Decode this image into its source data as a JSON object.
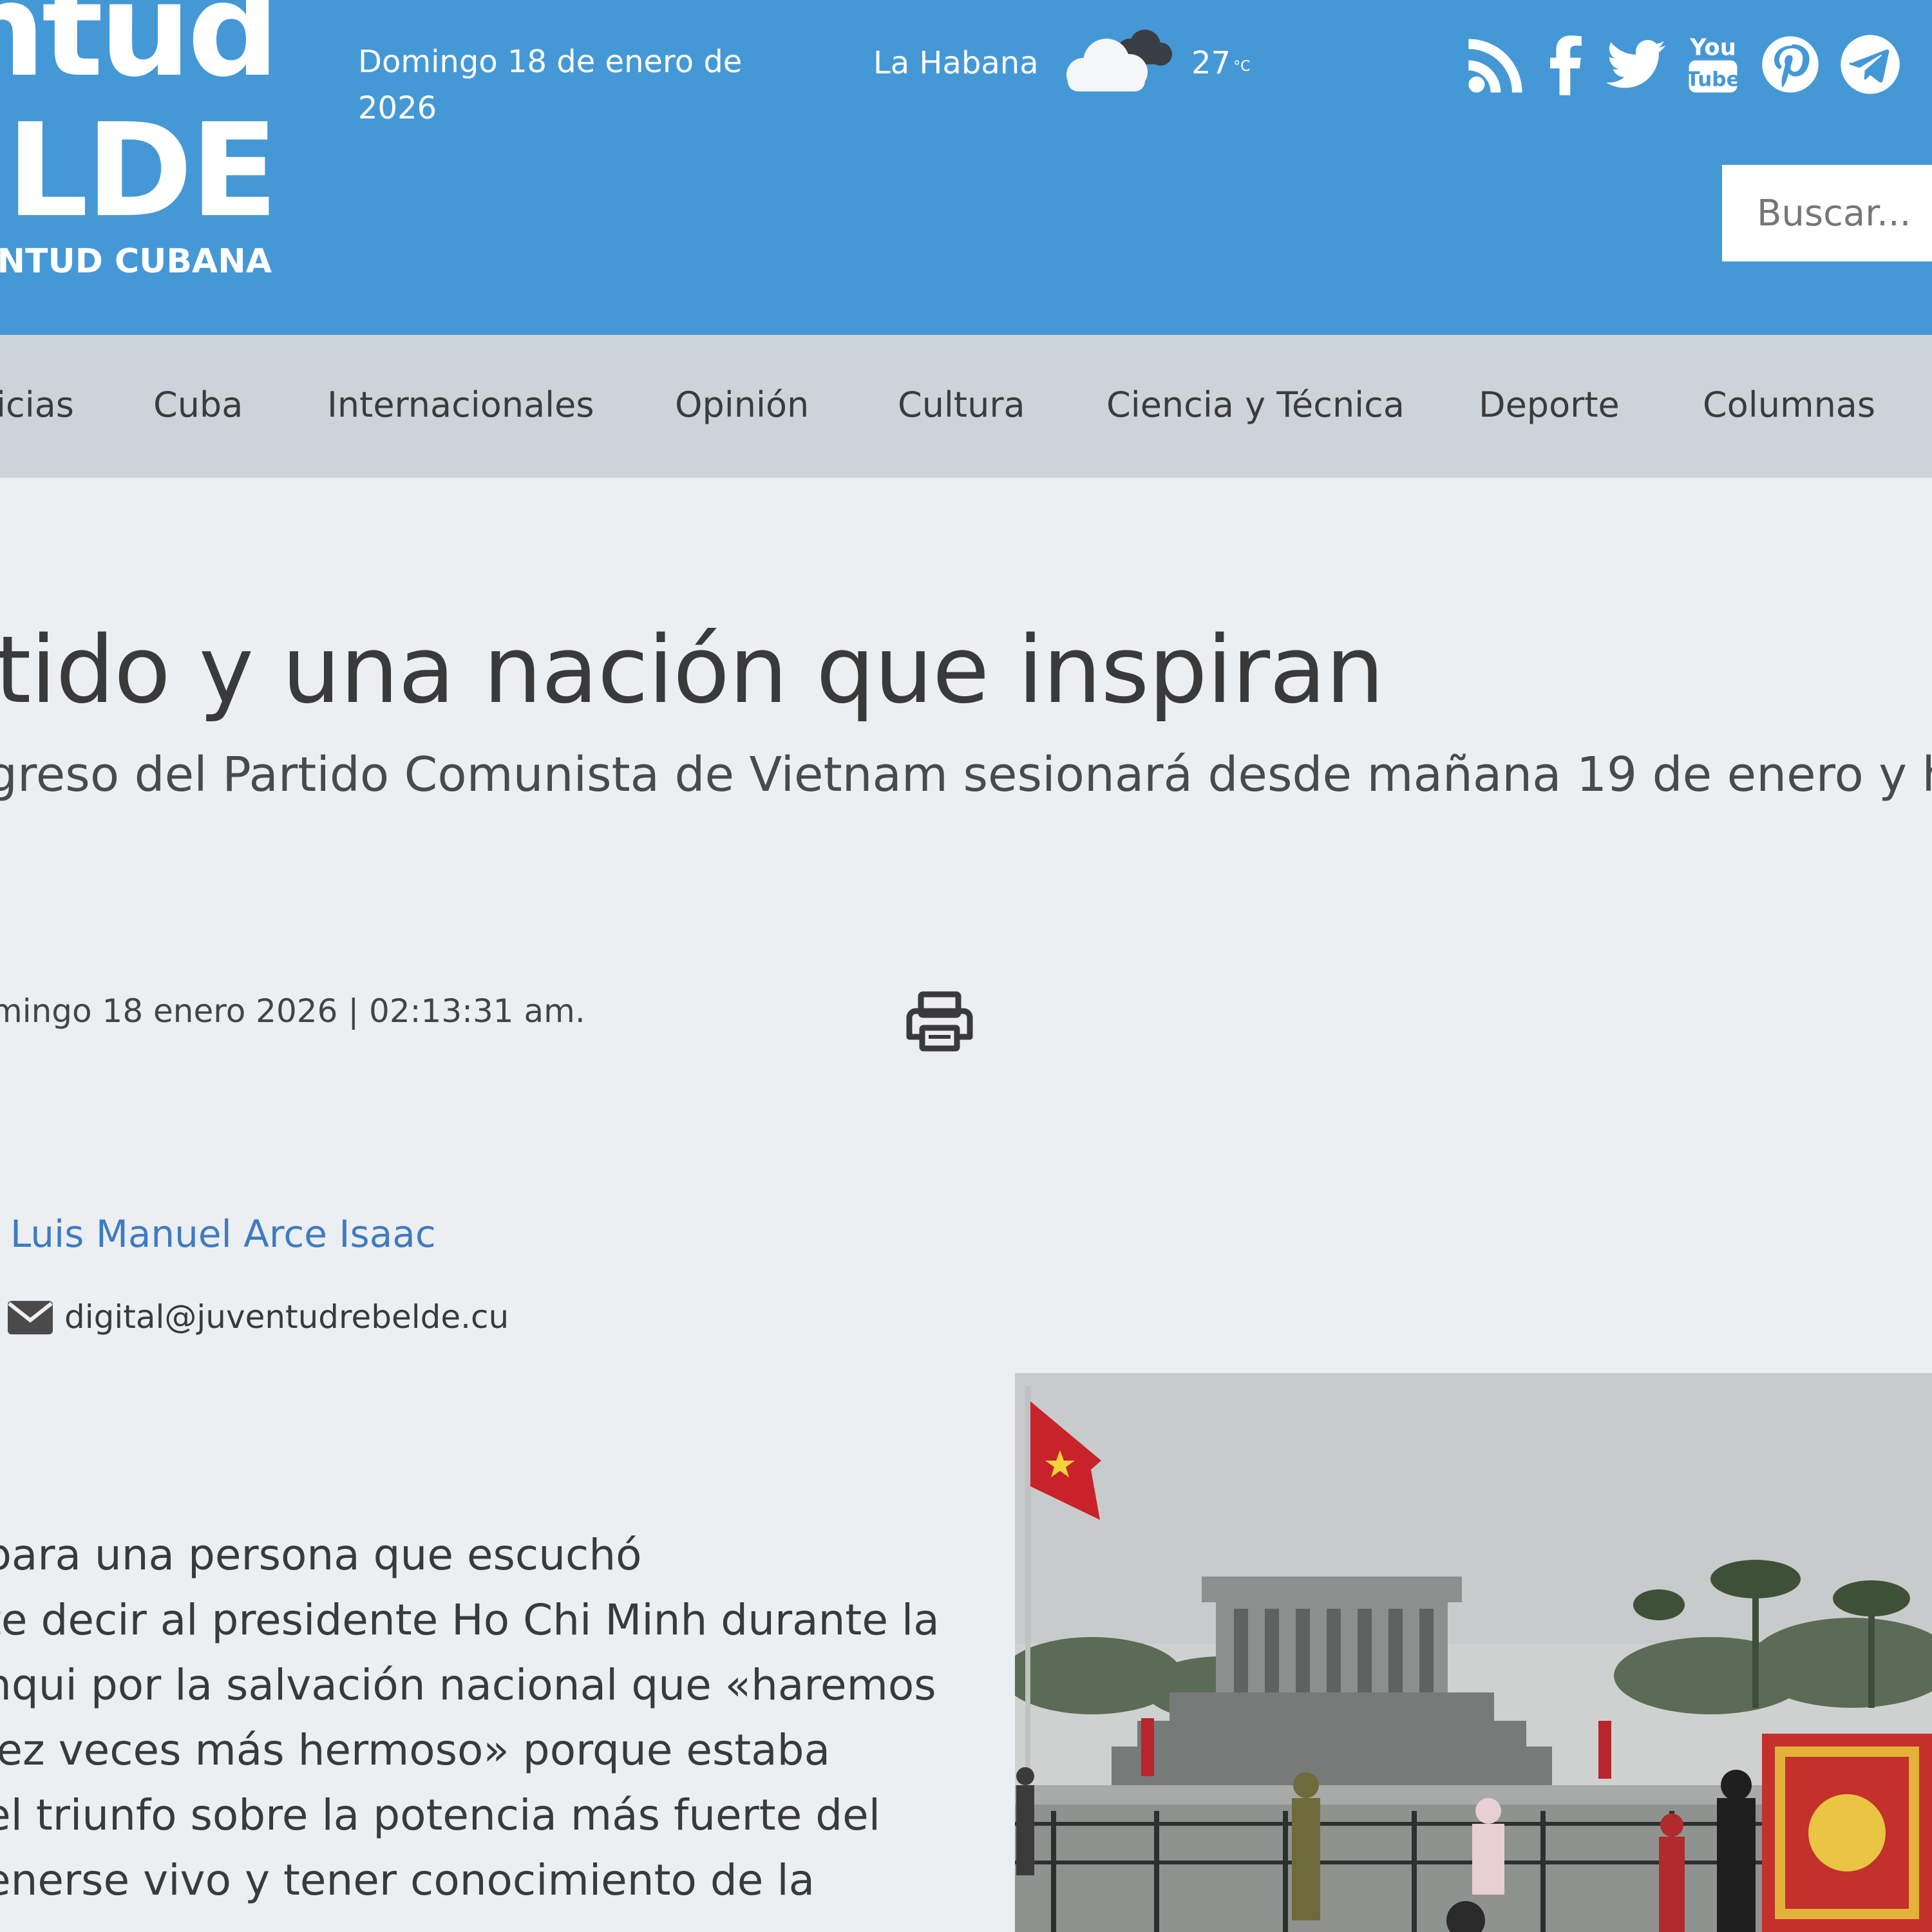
{
  "header": {
    "logo_line1": "ntud",
    "logo_line2": "ELDE",
    "logo_line3": "NTUD CUBANA",
    "date_line1": "Domingo 18 de enero de",
    "date_line2": "2026",
    "city": "La Habana",
    "weather_icon": "cloudy-icon",
    "temperature": "27",
    "temperature_unit": "°C",
    "social_icons": [
      "rss-icon",
      "facebook-icon",
      "twitter-icon",
      "youtube-icon",
      "pinterest-icon",
      "telegram-icon"
    ],
    "search_placeholder": "Buscar...",
    "bg_color": "#4598d6"
  },
  "nav": {
    "items": [
      "icias",
      "Cuba",
      "Internacionales",
      "Opinión",
      "Cultura",
      "Ciencia y Técnica",
      "Deporte",
      "Columnas"
    ],
    "bg_color": "#ccd4da"
  },
  "article": {
    "title": "tido y una nación que inspiran",
    "subtitle": "greso del Partido Comunista de Vietnam sesionará desde mañana 19 de enero y h",
    "date": "mingo 18 enero 2026 | 02:13:31 am.",
    "author": "Luis Manuel Arce Isaac",
    "email": "digital@juventudrebelde.cu",
    "author_color": "#3f7bc0",
    "body_lines": [
      "para una persona que escuchó",
      "te decir al presidente Ho Chi Minh durante la",
      "nqui por la salvación nacional que «haremos",
      "iez veces más hermoso» porque estaba",
      "el triunfo sobre la potencia más fuerte del",
      "enerse vivo y tener conocimiento de la"
    ]
  }
}
